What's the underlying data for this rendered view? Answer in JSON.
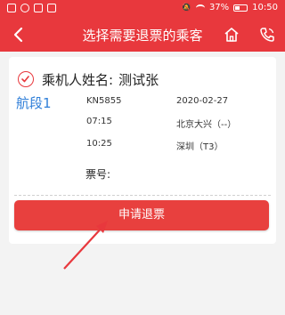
{
  "status_bar": {
    "battery": "37%",
    "time": "10:50",
    "battery_level": 0.37
  },
  "header": {
    "title": "选择需要退票的乘客",
    "back_icon": "chevron-left-icon",
    "home_icon": "home-icon",
    "phone_icon": "phone-icon"
  },
  "passenger": {
    "name_label": "乘机人姓名:",
    "name": "测试张",
    "selected": true
  },
  "segment": {
    "label": "航段1",
    "flight_no": "KN5855",
    "date": "2020-02-27",
    "depart_time": "07:15",
    "depart_airport": "北京大兴（--）",
    "arrive_time": "10:25",
    "arrive_airport": "深圳（T3）",
    "ticket_label": "票号:"
  },
  "actions": {
    "refund_label": "申请退票"
  },
  "colors": {
    "brand_red": "#e8383d",
    "segment_blue": "#2e7ed8"
  }
}
